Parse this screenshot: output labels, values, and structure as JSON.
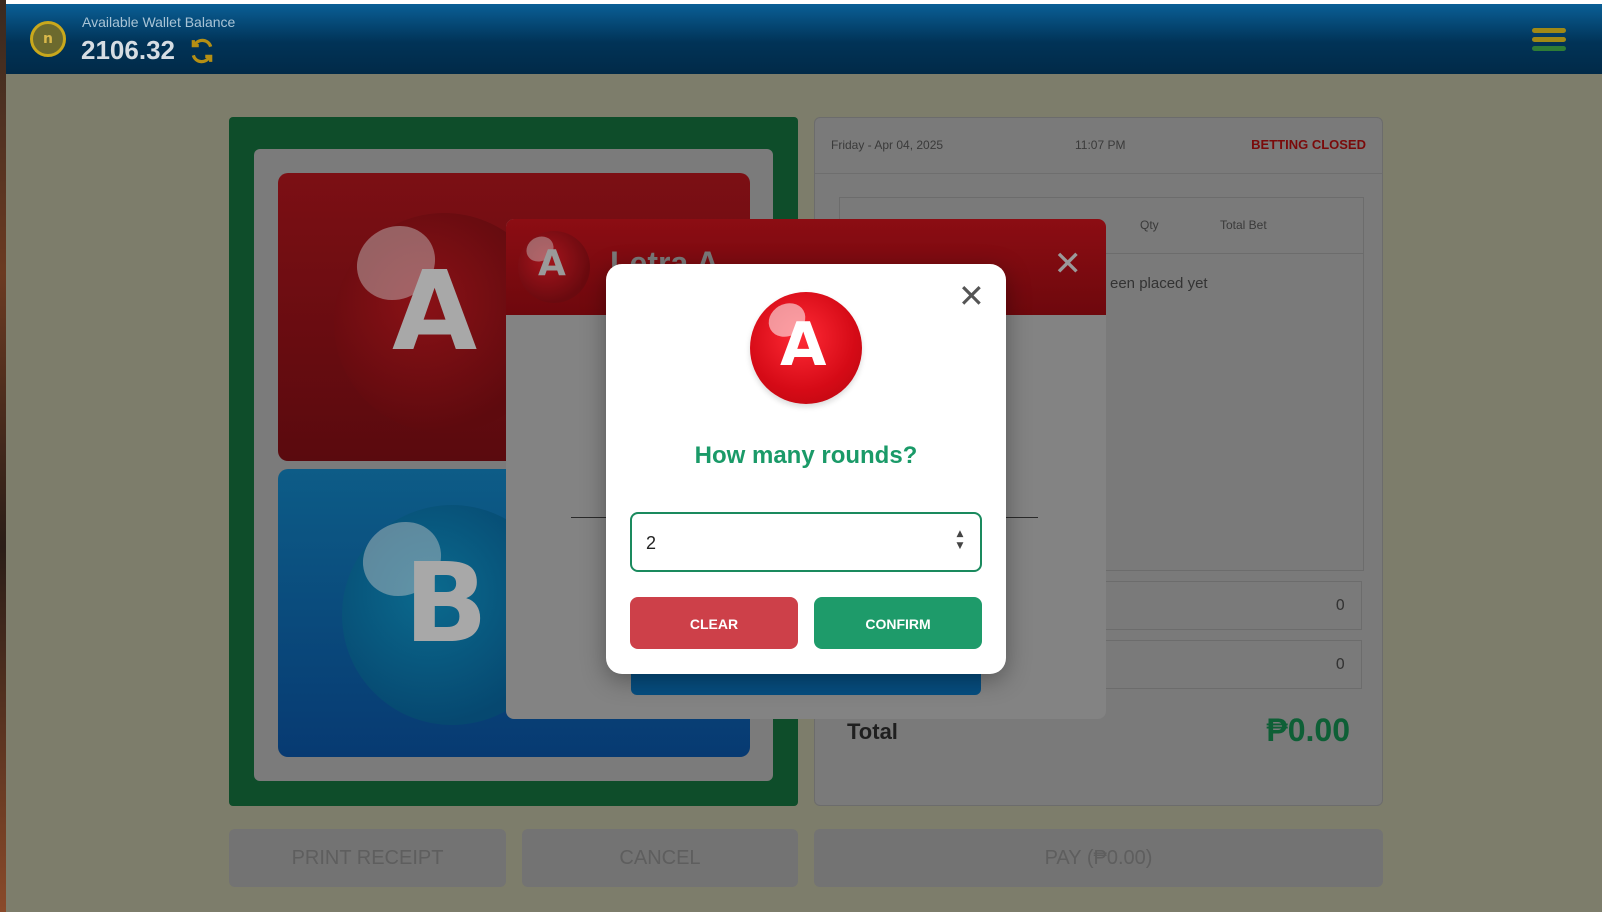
{
  "header": {
    "wallet_label": "Available Wallet Balance",
    "wallet_balance": "2106.32",
    "coin_glyph": "n"
  },
  "panel": {
    "date": "Friday - Apr 04, 2025",
    "time": "11:07 PM",
    "status": "BETTING CLOSED",
    "columns": [
      "Qty",
      "Total Bet"
    ],
    "empty_message": "een placed yet",
    "rows": [
      {
        "value": "0"
      },
      {
        "value": "0"
      }
    ],
    "total_label": "Total",
    "total_value": "₱0.00"
  },
  "board": {
    "tile_a_letter": "A",
    "tile_b_letter": "B"
  },
  "bottom": {
    "print_receipt": "PRINT RECEIPT",
    "cancel": "CANCEL",
    "pay": "PAY (₱0.00)"
  },
  "modal_bg": {
    "title": "Letra A",
    "ball_letter": "A",
    "close": "✕"
  },
  "dialog": {
    "ball_letter": "A",
    "close": "✕",
    "title": "How many rounds?",
    "input_value": "2",
    "clear_label": "CLEAR",
    "confirm_label": "CONFIRM"
  },
  "colors": {
    "accent_green": "#1e9b6a",
    "clear_red": "#cd4049",
    "header_blue": "#013357",
    "status_red": "#7a0a0a"
  }
}
